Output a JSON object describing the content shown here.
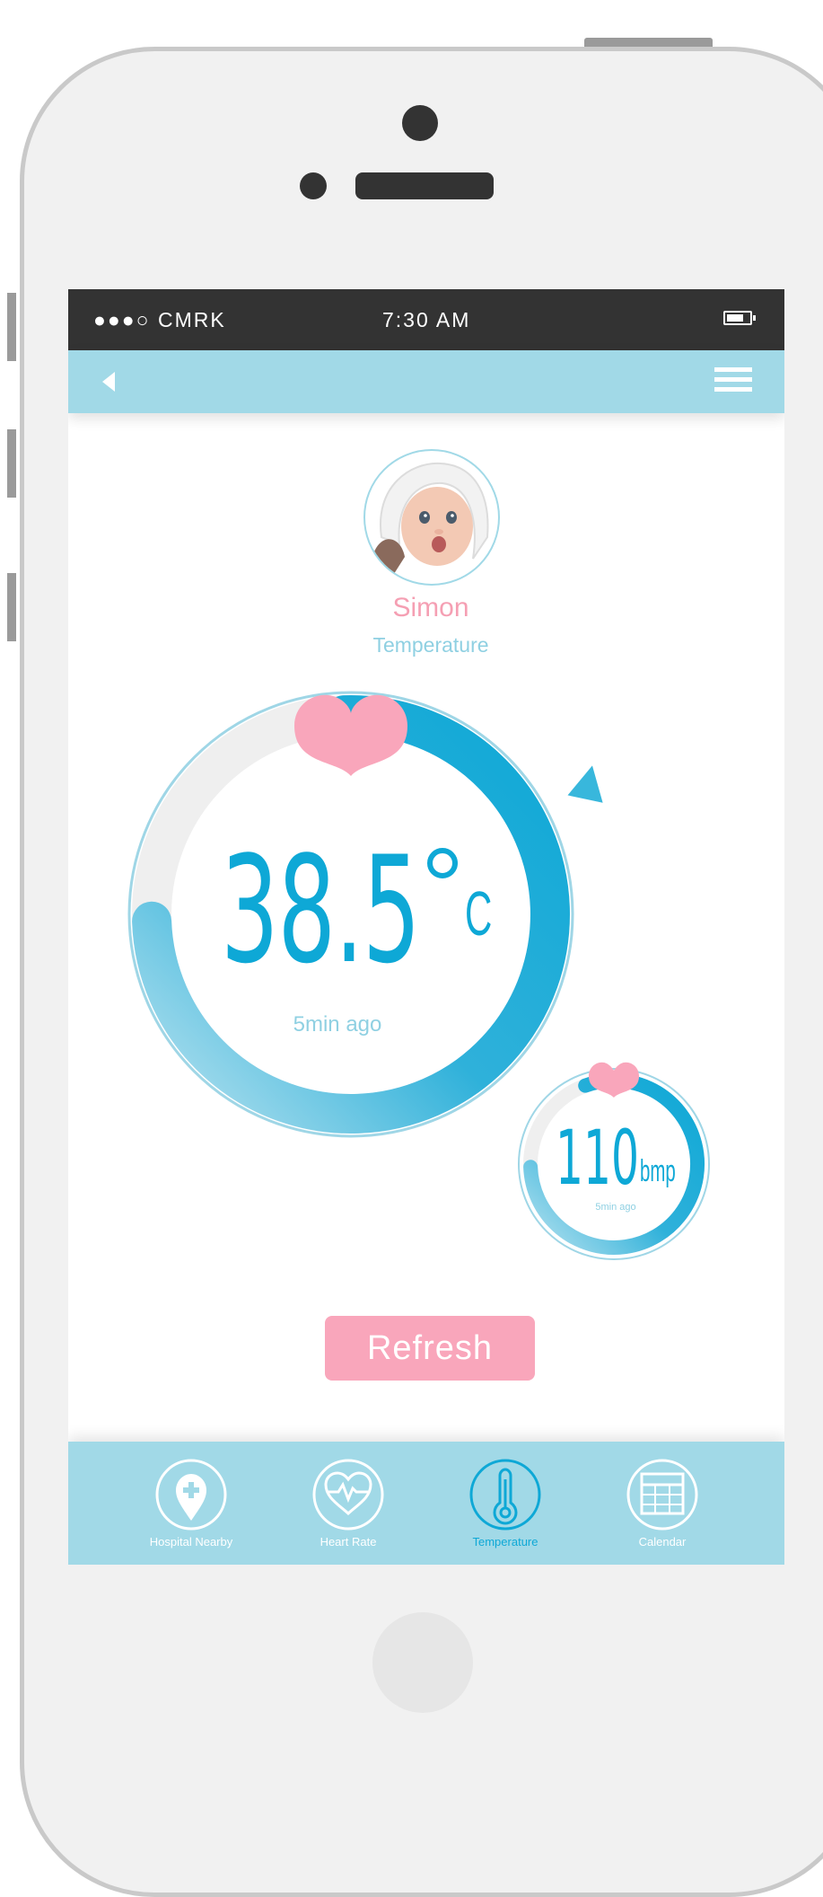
{
  "status_bar": {
    "carrier": "●●●○ CMRK",
    "time": "7:30 AM",
    "battery_icon": "battery-icon"
  },
  "nav": {
    "back_icon": "back-arrow-icon",
    "menu_icon": "hamburger-menu-icon"
  },
  "profile": {
    "name": "Simon",
    "subtitle": "Temperature"
  },
  "temperature": {
    "value": "38.5",
    "unit": "C",
    "ago": "5min ago",
    "progress": 0.75
  },
  "heart_rate": {
    "value": "110",
    "unit": "bmp",
    "ago": "5min ago",
    "progress": 0.8
  },
  "actions": {
    "refresh_label": "Refresh"
  },
  "tabs": [
    {
      "label": "Hospital Nearby",
      "icon": "hospital-location-icon"
    },
    {
      "label": "Heart Rate",
      "icon": "heart-rate-icon"
    },
    {
      "label": "Temperature",
      "icon": "thermometer-icon",
      "active": true
    },
    {
      "label": "Calendar",
      "icon": "calendar-icon"
    }
  ],
  "colors": {
    "accent": "#0ea8d6",
    "nav_bg": "#a1d9e7",
    "pink": "#f9a6bb",
    "status_bar": "#333333"
  }
}
